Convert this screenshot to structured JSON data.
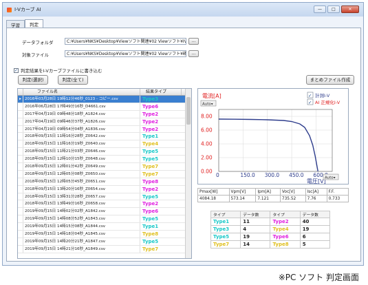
{
  "window": {
    "title": "I-Vカーブ AI",
    "min": "—",
    "max": "□",
    "close": "✕"
  },
  "tabs": [
    {
      "label": "学習"
    },
    {
      "label": "判定"
    }
  ],
  "data_folder": {
    "label": "データフォルダ",
    "path": "C:¥Users¥NKS¥Desktop¥Viewソフト関連¥02 Viewソフト¥IVデ",
    "browse": "..."
  },
  "target_file": {
    "label": "対象ファイル",
    "path": "C:¥Users¥NKS¥Desktop¥Viewソフト関連¥02 Viewソフト¥確認",
    "browse": "..."
  },
  "write_option": {
    "label": "判定結果をI-Vカーブファイルに書き込む",
    "checked": "✓"
  },
  "buttons": {
    "judge_selected": "判定(選択)",
    "judge_all": "判定(全て)",
    "summary": "まとめファイル作成"
  },
  "grid": {
    "headers": [
      "ファイル名",
      "結果タイプ"
    ],
    "rows": [
      {
        "file": "2016年03月28日 19時12分46秒_0123 - コピー.csv",
        "type": "Type3",
        "color": "#18c8c8"
      },
      {
        "file": "2016年06月28日 17時49分16秒_D4661.csv",
        "type": "Type6",
        "color": "#e020e0"
      },
      {
        "file": "2017年04月19日 09時48分18秒_A1824.csv",
        "type": "Type2",
        "color": "#e020e0"
      },
      {
        "file": "2017年04月19日 09時46分37秒_A1826.csv",
        "type": "Type2",
        "color": "#e020e0"
      },
      {
        "file": "2017年04月19日 09時54分04秒_A1836.csv",
        "type": "Type2",
        "color": "#e020e0"
      },
      {
        "file": "2018年09月15日 11時16分28秒_Z0642.csv",
        "type": "Type1",
        "color": "#18c8c8"
      },
      {
        "file": "2018年09月15日 11時16分19秒_Z0640.csv",
        "type": "Type4",
        "color": "#e0c020"
      },
      {
        "file": "2018年09月15日 11時21分03秒_Z0646.csv",
        "type": "Type5",
        "color": "#18c8c8"
      },
      {
        "file": "2018年09月15日 12時10分15秒_Z0648.csv",
        "type": "Type5",
        "color": "#18c8c8"
      },
      {
        "file": "2018年09月15日 12時01分42秒_Z0649.csv",
        "type": "Type7",
        "color": "#e0c020"
      },
      {
        "file": "2018年09月15日 12時05分08秒_Z0650.csv",
        "type": "Type7",
        "color": "#e0c020"
      },
      {
        "file": "2018年09月15日 12時05分45秒_Z0651.csv",
        "type": "Type8",
        "color": "#e020e0"
      },
      {
        "file": "2018年09月15日 13時20分16秒_Z0654.csv",
        "type": "Type2",
        "color": "#e020e0"
      },
      {
        "file": "2018年09月15日 13時31分28秒_Z0657.csv",
        "type": "Type5",
        "color": "#18c8c8"
      },
      {
        "file": "2018年09月15日 13時49分16秒_Z0658.csv",
        "type": "Type2",
        "color": "#e020e0"
      },
      {
        "file": "2019年09月15日 14時02分02秒_A1842.csv",
        "type": "Type6",
        "color": "#e020e0"
      },
      {
        "file": "2019年09月15日 14時08分52秒_A1843.csv",
        "type": "Type5",
        "color": "#18c8c8"
      },
      {
        "file": "2019年09月15日 14時15分08秒_A1844.csv",
        "type": "Type1",
        "color": "#18c8c8"
      },
      {
        "file": "2019年09月15日 14時18分04秒_A1845.csv",
        "type": "Type8",
        "color": "#e0c020"
      },
      {
        "file": "2019年09月15日 14時20分21秒_A1847.csv",
        "type": "Type5",
        "color": "#18c8c8"
      },
      {
        "file": "2019年09月15日 14時21分16秒_A1849.csv",
        "type": "Type7",
        "color": "#e0c020"
      }
    ]
  },
  "chart_data": {
    "type": "line",
    "ylabel": "電流[A]",
    "xlabel": "電圧[V]",
    "y_ticks": [
      "0.00",
      "2.00",
      "4.00",
      "6.00",
      "8.00"
    ],
    "x_ticks": [
      "0",
      "150.0",
      "300.0",
      "450.0",
      "600.0"
    ],
    "xlim": [
      0,
      700
    ],
    "ylim": [
      0,
      9
    ],
    "legend": [
      {
        "label": "計測I-V",
        "checked": "✓"
      },
      {
        "label": "AI 正規化I-V",
        "checked": "✓"
      }
    ],
    "auto_label": "Auto",
    "x": [
      0,
      100,
      200,
      300,
      400,
      450,
      500,
      530,
      560,
      580,
      595,
      605,
      612
    ],
    "y": [
      7.6,
      7.58,
      7.55,
      7.5,
      7.4,
      7.25,
      6.9,
      6.4,
      5.2,
      3.8,
      2.2,
      0.9,
      0.0
    ],
    "line_color": "#2d3c8c"
  },
  "params": {
    "headers": [
      "Pmax[W]",
      "Vpm[V]",
      "Ipm[A]",
      "Voc[V]",
      "Isc[A]",
      "F.F."
    ],
    "values": [
      "4084.18",
      "573.14",
      "7.121",
      "735.52",
      "7.76",
      "0.733"
    ]
  },
  "counts": {
    "headers": [
      "タイプ",
      "データ数",
      "タイプ",
      "データ数"
    ],
    "rows": [
      [
        {
          "t": "Type1",
          "c": "#18c8c8"
        },
        "11",
        {
          "t": "Type2",
          "c": "#e020e0"
        },
        "40"
      ],
      [
        {
          "t": "Type3",
          "c": "#18c8c8"
        },
        "4",
        {
          "t": "Type4",
          "c": "#e0c020"
        },
        "19"
      ],
      [
        {
          "t": "Type5",
          "c": "#18c8c8"
        },
        "19",
        {
          "t": "Type6",
          "c": "#e020e0"
        },
        "6"
      ],
      [
        {
          "t": "Type7",
          "c": "#e0c020"
        },
        "14",
        {
          "t": "Type8",
          "c": "#e0c020"
        },
        "5"
      ]
    ]
  },
  "caption": "※PC ソフト 判定画面"
}
